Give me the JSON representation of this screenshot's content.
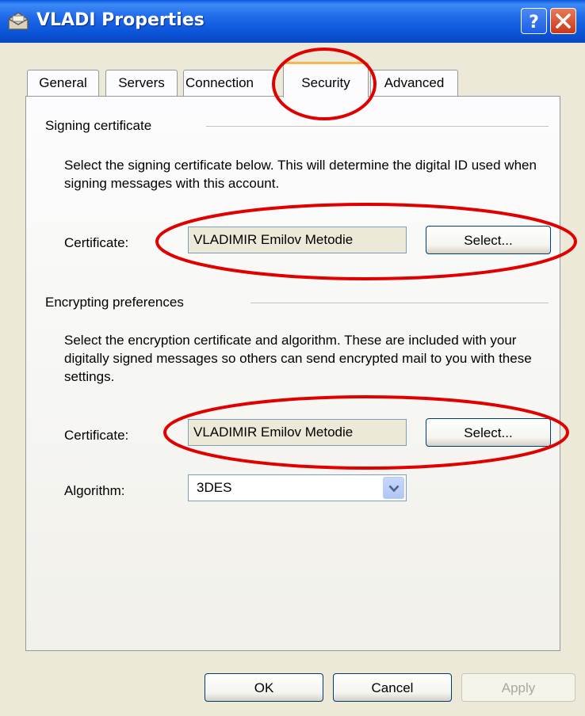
{
  "window": {
    "title": "VLADI Properties",
    "icons": {
      "app": "envelope-icon",
      "help": "help-icon",
      "close": "close-icon"
    }
  },
  "tabs": [
    {
      "label": "General",
      "active": false
    },
    {
      "label": "Servers",
      "active": false
    },
    {
      "label": "Connection",
      "active": false
    },
    {
      "label": "Security",
      "active": true
    },
    {
      "label": "Advanced",
      "active": false
    }
  ],
  "signing": {
    "group_label": "Signing certificate",
    "description": "Select the signing certificate below. This will determine the digital ID used when signing messages with this account.",
    "certificate_label": "Certificate:",
    "certificate_value": "VLADIMIR Emilov Metodie",
    "select_label": "Select..."
  },
  "encrypting": {
    "group_label": "Encrypting preferences",
    "description": "Select the encryption certificate and algorithm. These are included with your digitally signed messages so others can send encrypted mail to you with these settings.",
    "certificate_label": "Certificate:",
    "certificate_value": "VLADIMIR Emilov Metodie",
    "select_label": "Select...",
    "algorithm_label": "Algorithm:",
    "algorithm_value": "3DES"
  },
  "footer": {
    "ok_label": "OK",
    "cancel_label": "Cancel",
    "apply_label": "Apply",
    "apply_enabled": false
  },
  "colors": {
    "titlebar": "#0a55d8",
    "active_tab_accent": "#f5b64c",
    "highlight_ellipse": "#e00000"
  }
}
